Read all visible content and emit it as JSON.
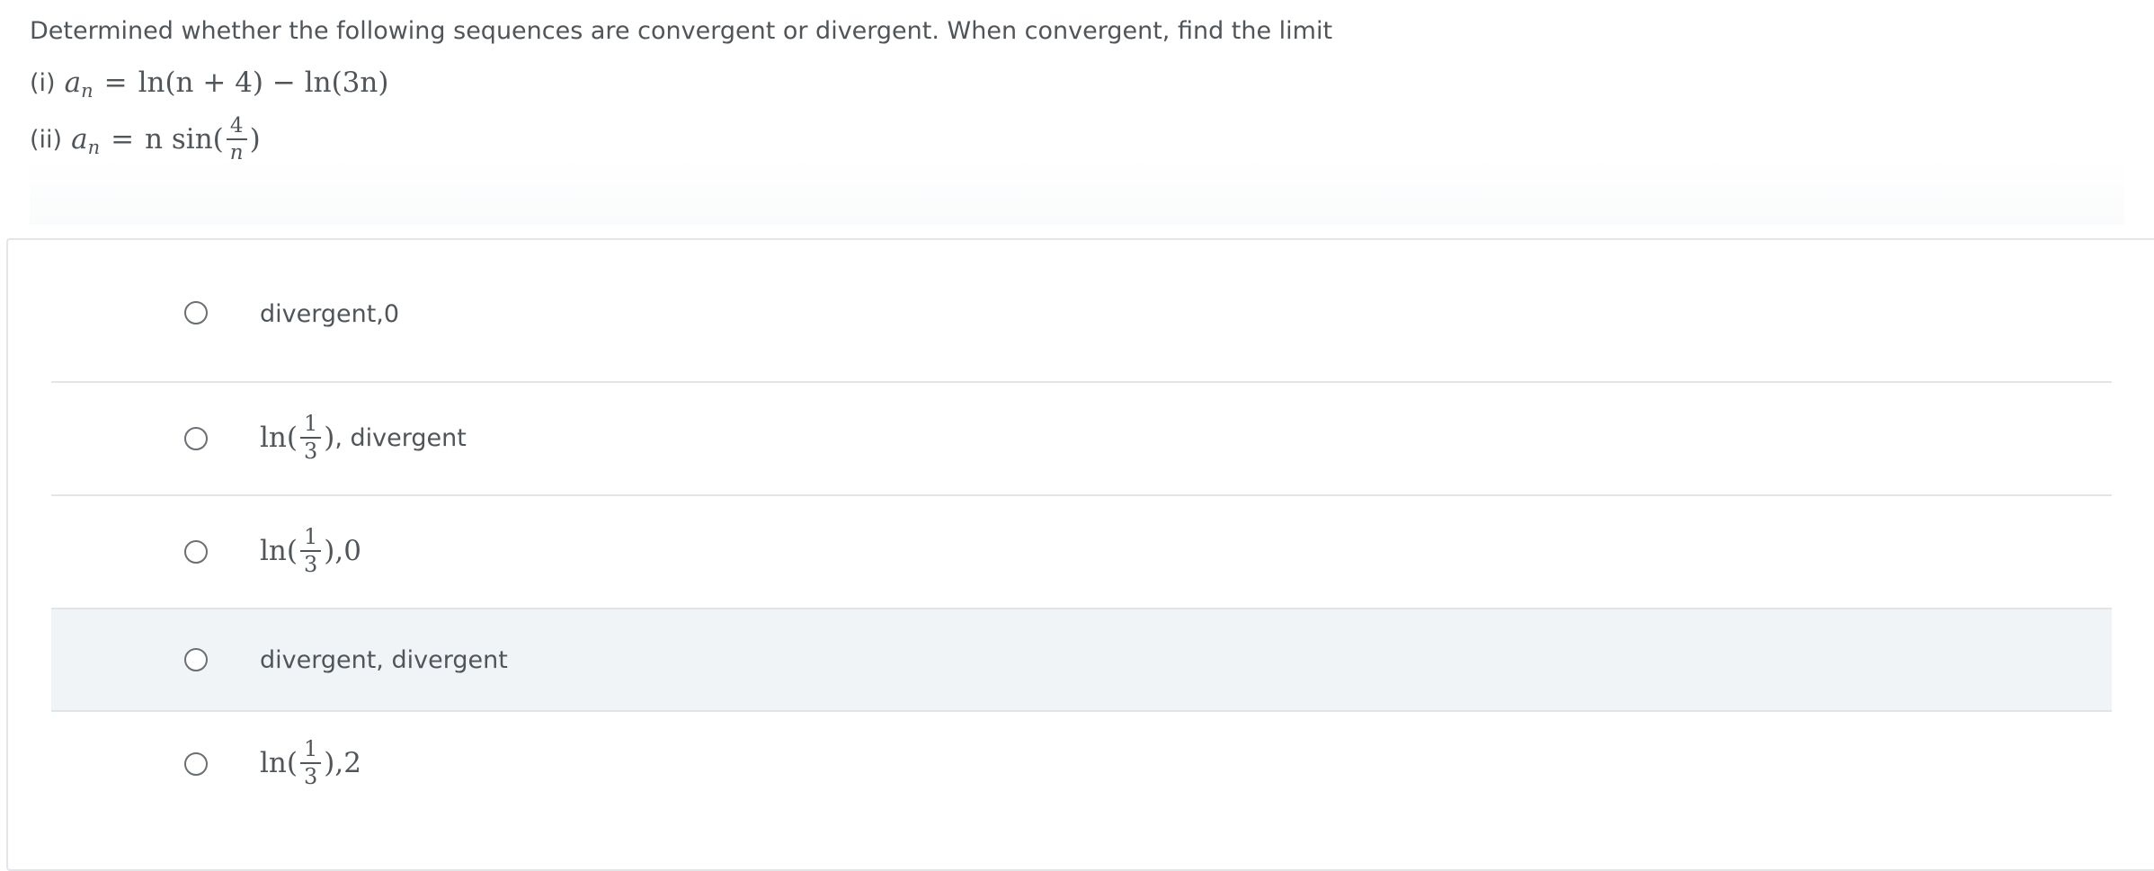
{
  "question": {
    "prompt": "Determined whether the following sequences are convergent or divergent. When convergent, find the limit",
    "part_i_label": "(i)",
    "part_i_lhs_var": "a",
    "part_i_lhs_sub": "n",
    "part_i_rhs": "ln(n + 4) − ln(3n)",
    "part_ii_label": "(ii)",
    "part_ii_lhs_var": "a",
    "part_ii_lhs_sub": "n",
    "part_ii_rhs_prefix": "n sin(",
    "part_ii_frac_num": "4",
    "part_ii_frac_den": "n",
    "part_ii_rhs_suffix": ")"
  },
  "options": [
    {
      "text": "divergent,0"
    },
    {
      "math_prefix": "ln(",
      "frac_num": "1",
      "frac_den": "3",
      "math_suffix": ")",
      "text": ", divergent"
    },
    {
      "math_prefix": "ln(",
      "frac_num": "1",
      "frac_den": "3",
      "math_suffix": ")",
      "text": ",0"
    },
    {
      "text": "divergent, divergent"
    },
    {
      "math_prefix": "ln(",
      "frac_num": "1",
      "frac_den": "3",
      "math_suffix": ")",
      "text": ",2"
    }
  ],
  "colors": {
    "text": "#505559",
    "divider": "#e2e5e8",
    "hover_row": "#f1f4f7",
    "radio_border": "#6a6f73"
  }
}
